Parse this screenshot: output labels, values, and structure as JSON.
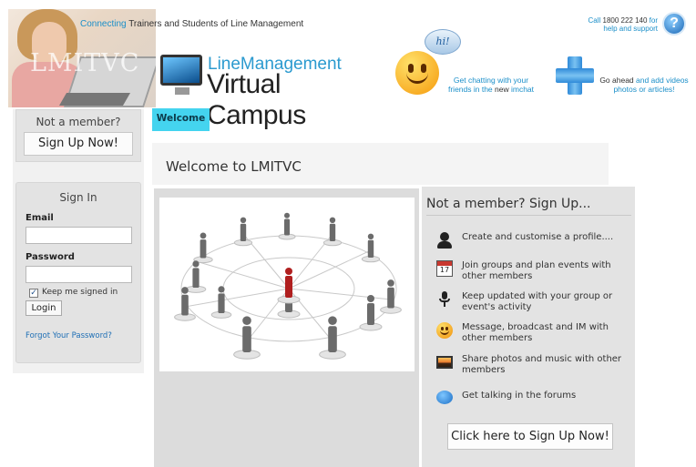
{
  "header": {
    "tagline_accent": "Connecting",
    "tagline_rest": " Trainers and Students of Line Management",
    "hero_watermark": "LMITVC",
    "logo_line1": "LineManagement",
    "logo_line2": "Virtual Campus",
    "help_call": "Call ",
    "help_number": "1800 222 140",
    "help_for": " for",
    "help_support": "help and support",
    "help_icon": "?",
    "chat_bubble": "hi!",
    "chat_line1": "Get chatting with your",
    "chat_line2a": "friends in the ",
    "chat_line2b": "new",
    "chat_line2c": " imchat",
    "add_line1a": "Go ahead",
    "add_line1b": " and add videos",
    "add_line2": "photos or articles!"
  },
  "sidebar": {
    "not_member": "Not a member?",
    "signup_button": "Sign Up Now!",
    "signin_title": "Sign In",
    "email_label": "Email",
    "email_value": "",
    "password_label": "Password",
    "password_value": "",
    "keep_signed_in": "Keep me signed in",
    "keep_signed_in_checked": "✓",
    "login_button": "Login",
    "forgot_link": "Forgot Your Password?"
  },
  "tabs": {
    "welcome": "Welcome"
  },
  "main": {
    "welcome_title": "Welcome to LMITVC",
    "signup_title": "Not a member? Sign Up...",
    "features": [
      {
        "icon": "person-icon",
        "text": "Create and customise a profile...."
      },
      {
        "icon": "calendar-icon",
        "text": "Join groups and plan events with other members",
        "calendar_day": "17"
      },
      {
        "icon": "microphone-icon",
        "text": "Keep updated with your group or event's activity"
      },
      {
        "icon": "smiley-icon",
        "text": "Message, broadcast and IM with other members"
      },
      {
        "icon": "photo-icon",
        "text": "Share photos and music with other members"
      },
      {
        "icon": "speech-bubble-icon",
        "text": "Get talking in the forums"
      }
    ],
    "cta_button": "Click here to Sign Up Now!"
  },
  "colors": {
    "accent_blue": "#1b8fc9",
    "tab_cyan": "#44d4ef",
    "panel_gray": "#e3e3e3",
    "highlight_figure": "#b01f1f"
  }
}
